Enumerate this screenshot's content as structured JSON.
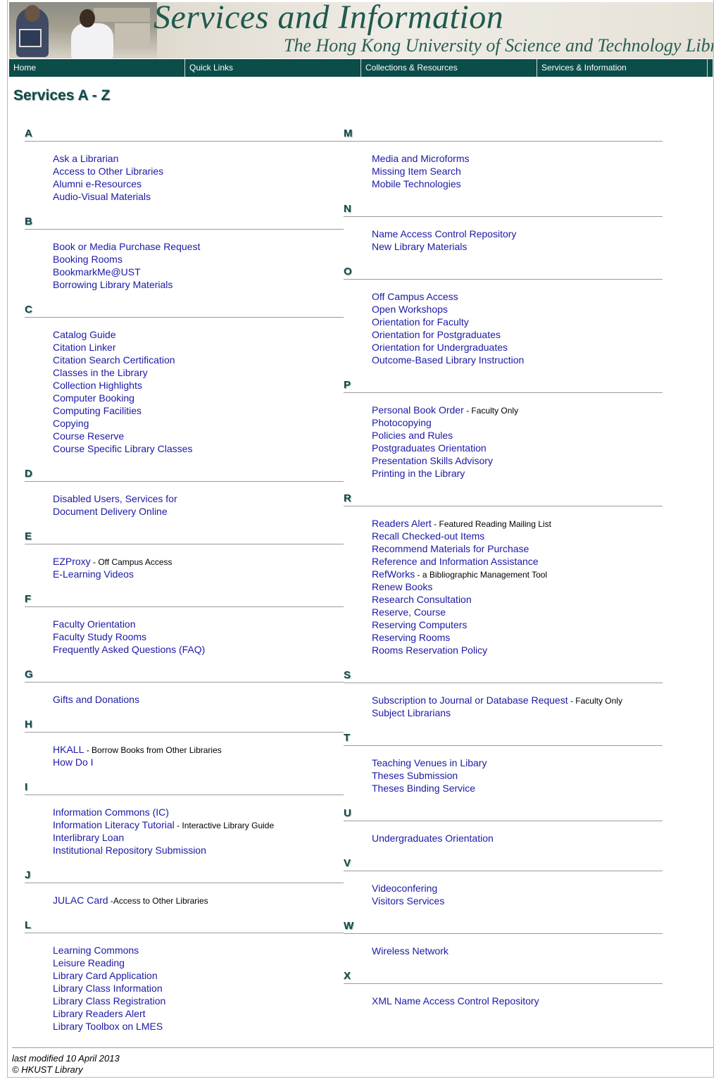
{
  "banner": {
    "title": "Services and Information",
    "subtitle": "The Hong Kong University of Science and Technology Library"
  },
  "nav": {
    "items": [
      {
        "label": "Home"
      },
      {
        "label": "Quick Links"
      },
      {
        "label": "Collections & Resources"
      },
      {
        "label": "Services & Information"
      }
    ]
  },
  "page": {
    "title": "Services A - Z"
  },
  "left_sections": [
    {
      "letter": "A",
      "items": [
        {
          "label": "Ask a Librarian",
          "note": ""
        },
        {
          "label": "Access to Other Libraries",
          "note": ""
        },
        {
          "label": "Alumni e-Resources",
          "note": ""
        },
        {
          "label": "Audio-Visual Materials",
          "note": ""
        }
      ]
    },
    {
      "letter": "B",
      "items": [
        {
          "label": "Book or Media Purchase Request",
          "note": ""
        },
        {
          "label": "Booking Rooms",
          "note": ""
        },
        {
          "label": "BookmarkMe@UST",
          "note": ""
        },
        {
          "label": "Borrowing Library Materials",
          "note": ""
        }
      ]
    },
    {
      "letter": "C",
      "items": [
        {
          "label": "Catalog Guide",
          "note": ""
        },
        {
          "label": "Citation Linker",
          "note": ""
        },
        {
          "label": "Citation Search Certification",
          "note": ""
        },
        {
          "label": "Classes in the Library",
          "note": ""
        },
        {
          "label": "Collection Highlights",
          "note": ""
        },
        {
          "label": "Computer Booking",
          "note": ""
        },
        {
          "label": "Computing Facilities",
          "note": ""
        },
        {
          "label": "Copying",
          "note": ""
        },
        {
          "label": "Course Reserve",
          "note": ""
        },
        {
          "label": "Course Specific Library Classes",
          "note": ""
        }
      ]
    },
    {
      "letter": "D",
      "items": [
        {
          "label": "Disabled Users, Services for",
          "note": ""
        },
        {
          "label": "Document Delivery Online",
          "note": ""
        }
      ]
    },
    {
      "letter": "E",
      "items": [
        {
          "label": "EZProxy",
          "note": " - Off Campus Access"
        },
        {
          "label": "E-Learning Videos",
          "note": ""
        }
      ]
    },
    {
      "letter": "F",
      "items": [
        {
          "label": "Faculty Orientation",
          "note": ""
        },
        {
          "label": "Faculty Study Rooms",
          "note": ""
        },
        {
          "label": "Frequently Asked Questions (FAQ)",
          "note": ""
        }
      ]
    },
    {
      "letter": "G",
      "items": [
        {
          "label": "Gifts and Donations",
          "note": ""
        }
      ]
    },
    {
      "letter": "H",
      "items": [
        {
          "label": "HKALL",
          "note": " - Borrow Books from Other Libraries"
        },
        {
          "label": "How Do I",
          "note": ""
        }
      ]
    },
    {
      "letter": "I",
      "items": [
        {
          "label": "Information Commons (IC)",
          "note": ""
        },
        {
          "label": "Information Literacy Tutorial",
          "note": " - Interactive Library Guide"
        },
        {
          "label": "Interlibrary Loan",
          "note": ""
        },
        {
          "label": "Institutional Repository Submission",
          "note": ""
        }
      ]
    },
    {
      "letter": "J",
      "items": [
        {
          "label": "JULAC Card",
          "note": " -Access to Other Libraries"
        }
      ]
    },
    {
      "letter": "L",
      "items": [
        {
          "label": "Learning Commons",
          "note": ""
        },
        {
          "label": "Leisure Reading",
          "note": ""
        },
        {
          "label": "Library Card Application",
          "note": ""
        },
        {
          "label": "Library Class Information",
          "note": ""
        },
        {
          "label": "Library Class Registration",
          "note": ""
        },
        {
          "label": "Library Readers Alert",
          "note": ""
        },
        {
          "label": "Library Toolbox on LMES",
          "note": ""
        }
      ]
    }
  ],
  "right_sections": [
    {
      "letter": "M",
      "items": [
        {
          "label": "Media and Microforms",
          "note": ""
        },
        {
          "label": "Missing Item Search",
          "note": ""
        },
        {
          "label": "Mobile Technologies",
          "note": ""
        }
      ]
    },
    {
      "letter": "N",
      "items": [
        {
          "label": "Name Access Control Repository",
          "note": ""
        },
        {
          "label": "New Library Materials",
          "note": ""
        }
      ]
    },
    {
      "letter": "O",
      "items": [
        {
          "label": "Off Campus Access",
          "note": ""
        },
        {
          "label": "Open Workshops",
          "note": ""
        },
        {
          "label": "Orientation for Faculty",
          "note": ""
        },
        {
          "label": "Orientation for Postgraduates",
          "note": ""
        },
        {
          "label": "Orientation for Undergraduates",
          "note": ""
        },
        {
          "label": "Outcome-Based Library Instruction",
          "note": ""
        }
      ]
    },
    {
      "letter": "P",
      "items": [
        {
          "label": "Personal Book Order",
          "note": " - Faculty Only"
        },
        {
          "label": "Photocopying",
          "note": ""
        },
        {
          "label": "Policies and Rules",
          "note": ""
        },
        {
          "label": "Postgraduates Orientation",
          "note": ""
        },
        {
          "label": "Presentation Skills Advisory",
          "note": ""
        },
        {
          "label": "Printing in the Library",
          "note": ""
        }
      ]
    },
    {
      "letter": "R",
      "items": [
        {
          "label": "Readers Alert",
          "note": " - Featured Reading Mailing List"
        },
        {
          "label": "Recall Checked-out Items",
          "note": ""
        },
        {
          "label": "Recommend Materials for Purchase",
          "note": ""
        },
        {
          "label": "Reference and Information Assistance",
          "note": ""
        },
        {
          "label": "RefWorks",
          "note": " - a Bibliographic Management Tool"
        },
        {
          "label": "Renew Books",
          "note": ""
        },
        {
          "label": "Research Consultation",
          "note": ""
        },
        {
          "label": "Reserve, Course",
          "note": ""
        },
        {
          "label": "Reserving Computers",
          "note": ""
        },
        {
          "label": "Reserving Rooms",
          "note": ""
        },
        {
          "label": "Rooms Reservation Policy",
          "note": ""
        }
      ]
    },
    {
      "letter": "S",
      "items": [
        {
          "label": "Subscription to Journal or Database Request",
          "note": " - Faculty Only"
        },
        {
          "label": "Subject Librarians",
          "note": ""
        }
      ]
    },
    {
      "letter": "T",
      "items": [
        {
          "label": "Teaching Venues in Libary",
          "note": ""
        },
        {
          "label": "Theses Submission",
          "note": ""
        },
        {
          "label": "Theses Binding Service",
          "note": ""
        }
      ]
    },
    {
      "letter": "U",
      "items": [
        {
          "label": "Undergraduates Orientation",
          "note": ""
        }
      ]
    },
    {
      "letter": "V",
      "items": [
        {
          "label": "Videoconfering",
          "note": ""
        },
        {
          "label": "Visitors Services",
          "note": ""
        }
      ]
    },
    {
      "letter": "W",
      "items": [
        {
          "label": "Wireless Network",
          "note": ""
        }
      ]
    },
    {
      "letter": "X",
      "items": [
        {
          "label": "XML Name Access Control Repository",
          "note": ""
        }
      ]
    }
  ],
  "footer": {
    "modified": "last modified 10 April 2013",
    "copyright": "© HKUST Library"
  }
}
